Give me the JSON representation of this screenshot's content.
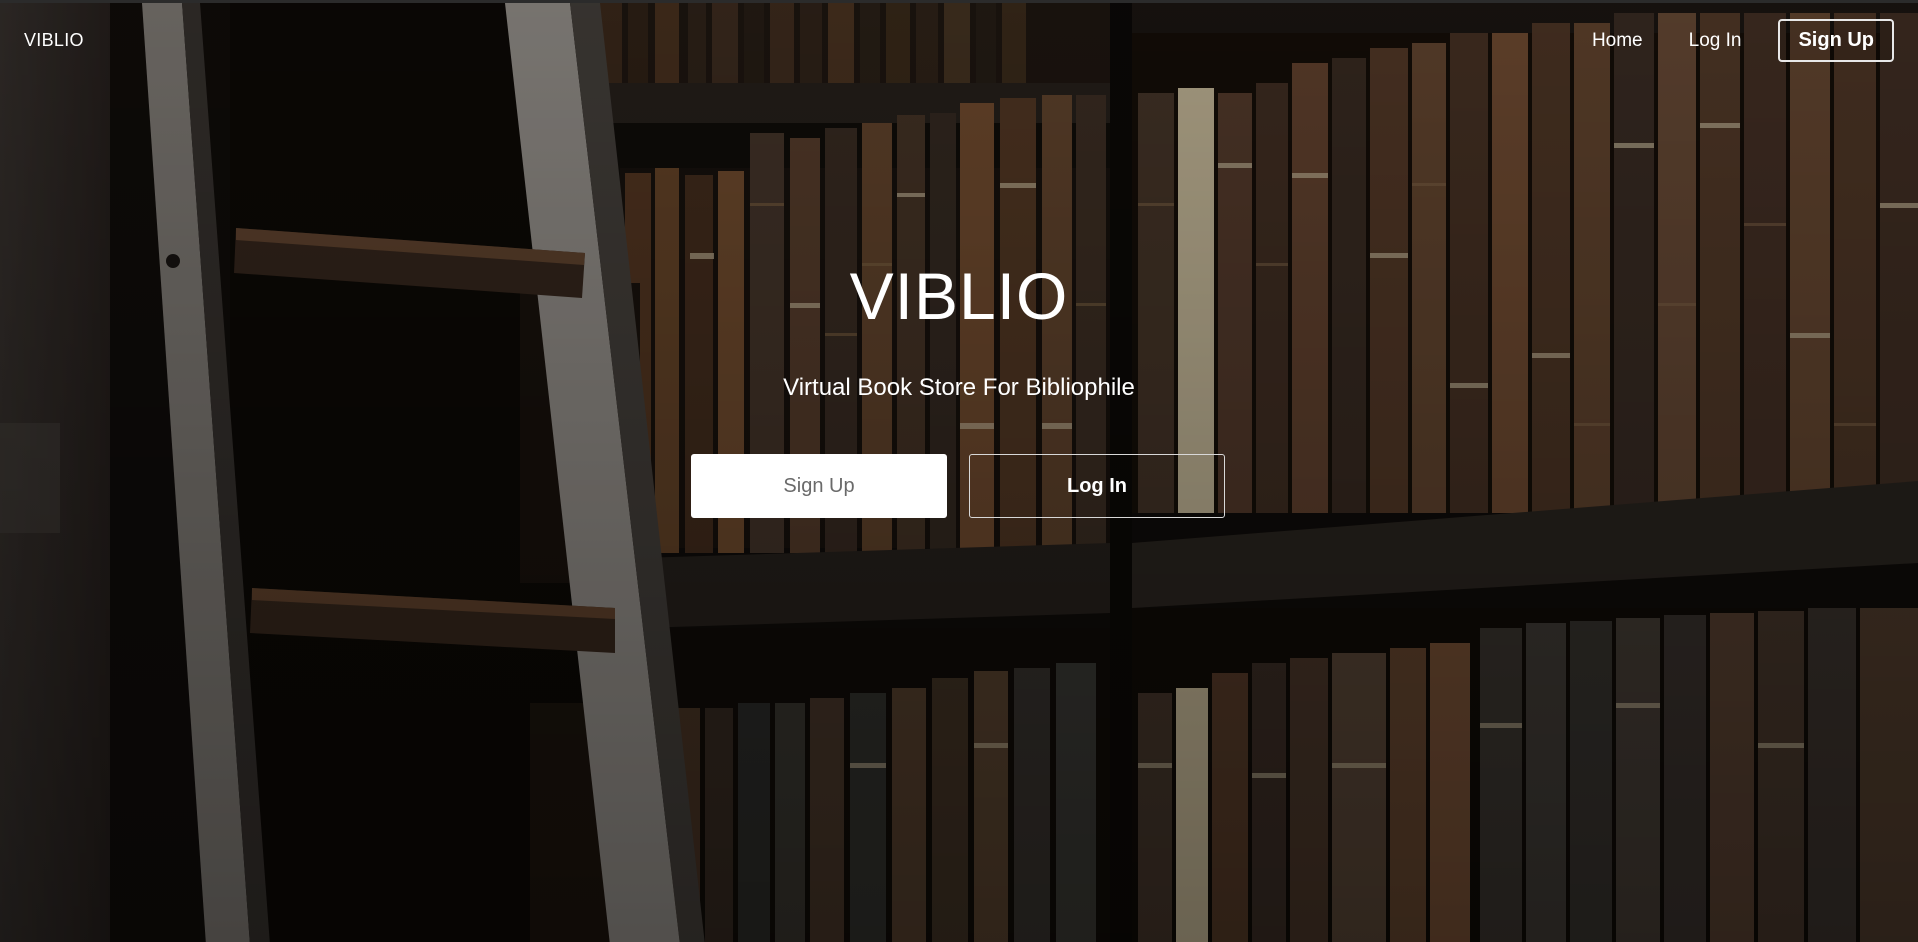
{
  "navbar": {
    "brand": "VIBLIO",
    "links": {
      "home": "Home",
      "login": "Log In",
      "signup": "Sign Up"
    }
  },
  "hero": {
    "title": "VIBLIO",
    "subtitle": "Virtual Book Store For Bibliophile",
    "signup_button": "Sign Up",
    "login_button": "Log In",
    "background": "bookshelf-with-ladder-photo"
  },
  "colors": {
    "overlay": "#000000",
    "text": "#ffffff",
    "primary_button_bg": "#ffffff",
    "primary_button_text": "#6a6a6a"
  }
}
